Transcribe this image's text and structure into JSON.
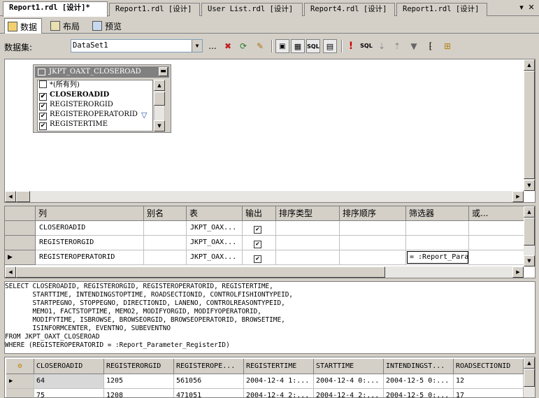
{
  "doc_tabs": [
    {
      "label": "Report1.rdl [设计]*",
      "active": true
    },
    {
      "label": "Report1.rdl [设计]",
      "active": false
    },
    {
      "label": "User List.rdl [设计]",
      "active": false
    },
    {
      "label": "Report4.rdl [设计]",
      "active": false
    },
    {
      "label": "Report1.rdl [设计]",
      "active": false
    }
  ],
  "tab_controls": {
    "dropdown": "▾",
    "close": "✕"
  },
  "view_tabs": [
    {
      "label": "数据",
      "active": true
    },
    {
      "label": "布局",
      "active": false
    },
    {
      "label": "预览",
      "active": false
    }
  ],
  "toolbar": {
    "dataset_label": "数据集:",
    "dataset_value": "DataSet1",
    "more_label": "..."
  },
  "diagram": {
    "table_name": "JKPT_OAXT_CLOSEROAD",
    "columns": [
      {
        "name": "*(所有列)",
        "checked": false,
        "bold": false
      },
      {
        "name": "CLOSEROADID",
        "checked": true,
        "bold": true
      },
      {
        "name": "REGISTERORGID",
        "checked": true,
        "bold": false
      },
      {
        "name": "REGISTEROPERATORID",
        "checked": true,
        "bold": false,
        "filtered": true
      },
      {
        "name": "REGISTERTIME",
        "checked": true,
        "bold": false
      }
    ]
  },
  "grid": {
    "headers": [
      "列",
      "别名",
      "表",
      "输出",
      "排序类型",
      "排序顺序",
      "筛选器",
      "或..."
    ],
    "rows": [
      {
        "column": "CLOSEROADID",
        "alias": "",
        "table": "JKPT_OAX...",
        "output": true,
        "current": false
      },
      {
        "column": "REGISTERORGID",
        "alias": "",
        "table": "JKPT_OAX...",
        "output": true,
        "current": false
      },
      {
        "column": "REGISTEROPERATORID",
        "alias": "",
        "table": "JKPT_OAX...",
        "output": true,
        "current": true,
        "filter": "= :Report_Para"
      }
    ]
  },
  "sql_text": "SELECT CLOSEROADID, REGISTERORGID, REGISTEROPERATORID, REGISTERTIME,\n       STARTTIME, INTENDINGSTOPTIME, ROADSECTIONID, CONTROLFISHIONTYPEID,\n       STARTPEGNO, STOPPEGNO, DIRECTIONID, LANENO, CONTROLREASONTYPEID,\n       MEMO1, FACTSTOPTIME, MEMO2, MODIFYORGID, MODIFYOPERATORID,\n       MODIFYTIME, ISBROWSE, BROWSEORGID, BROWSEOPERATORID, BROWSETIME,\n       ISINFORMCENTER, EVENTNO, SUBEVENTNO\nFROM JKPT_OAXT_CLOSEROAD\nWHERE (REGISTEROPERATORID = :Report_Parameter_RegisterID)",
  "results": {
    "headers": [
      "CLOSEROADID",
      "REGISTERORGID",
      "REGISTEROPE...",
      "REGISTERTIME",
      "STARTTIME",
      "INTENDINGST...",
      "ROADSECTIONID"
    ],
    "rows": [
      [
        "64",
        "1205",
        "561056",
        "2004-12-4 1:...",
        "2004-12-4 0:...",
        "2004-12-5 0:...",
        "12"
      ],
      [
        "75",
        "1208",
        "471051",
        "2004-12-4 2:...",
        "2004-12-4 2:...",
        "2004-12-5 0:...",
        "17"
      ]
    ]
  }
}
